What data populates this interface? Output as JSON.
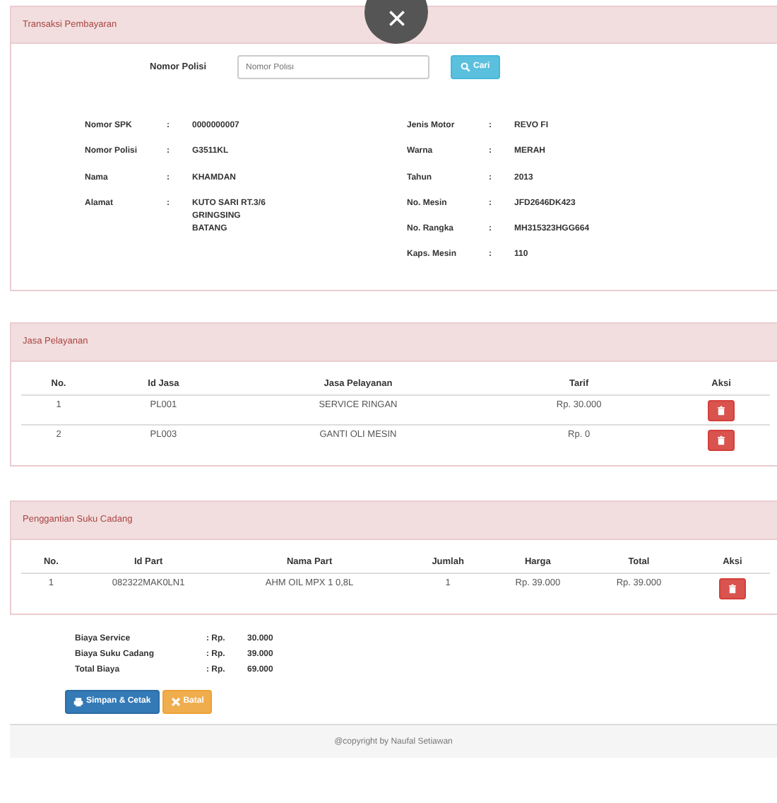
{
  "transaction": {
    "title": "Transaksi Pembayaran",
    "search": {
      "label": "Nomor Polisi",
      "placeholder": "Nomor Polisi",
      "button": "Cari"
    },
    "left_fields": [
      {
        "label": "Nomor SPK",
        "colon": ":",
        "lines": [
          "0000000007"
        ]
      },
      {
        "label": "Nomor Polisi",
        "colon": ":",
        "lines": [
          "G3511KL"
        ]
      },
      {
        "label": "Nama",
        "colon": ":",
        "lines": [
          "KHAMDAN"
        ]
      },
      {
        "label": "Alamat",
        "colon": ":",
        "lines": [
          "KUTO SARI RT.3/6",
          "GRINGSING",
          "BATANG"
        ]
      }
    ],
    "right_fields": [
      {
        "label": "Jenis Motor",
        "colon": ":",
        "lines": [
          "REVO FI"
        ]
      },
      {
        "label": "Warna",
        "colon": ":",
        "lines": [
          "MERAH"
        ]
      },
      {
        "label": "Tahun",
        "colon": ":",
        "lines": [
          "2013"
        ]
      },
      {
        "label": "No. Mesin",
        "colon": ":",
        "lines": [
          "JFD2646DK423"
        ]
      },
      {
        "label": "No. Rangka",
        "colon": ":",
        "lines": [
          "MH315323HGG664"
        ]
      },
      {
        "label": "Kaps. Mesin",
        "colon": ":",
        "lines": [
          "110"
        ]
      }
    ]
  },
  "services": {
    "title": "Jasa Pelayanan",
    "columns": [
      "No.",
      "Id Jasa",
      "Jasa Pelayanan",
      "Tarif",
      "Aksi"
    ],
    "rows": [
      [
        "1",
        "PL001",
        "SERVICE RINGAN",
        "Rp. 30.000"
      ],
      [
        "2",
        "PL003",
        "GANTI OLI MESIN",
        "Rp. 0"
      ]
    ]
  },
  "parts": {
    "title": "Penggantian Suku Cadang",
    "columns": [
      "No.",
      "Id Part",
      "Nama Part",
      "Jumlah",
      "Harga",
      "Total",
      "Aksi"
    ],
    "rows": [
      [
        "1",
        "082322MAK0LN1",
        "AHM OIL MPX 1 0,8L",
        "1",
        "Rp. 39.000",
        "Rp. 39.000"
      ]
    ]
  },
  "summary": [
    {
      "label": "Biaya Service",
      "currency": ": Rp.",
      "amount": "30.000"
    },
    {
      "label": "Biaya Suku Cadang",
      "currency": ": Rp.",
      "amount": "39.000"
    },
    {
      "label": "Total Biaya",
      "currency": ": Rp.",
      "amount": "69.000"
    }
  ],
  "buttons": [
    {
      "label": "Simpan & Cetak",
      "kind": "save"
    },
    {
      "label": "Batal",
      "kind": "cancel"
    }
  ],
  "footer": "@copyright by Naufal Setiawan"
}
